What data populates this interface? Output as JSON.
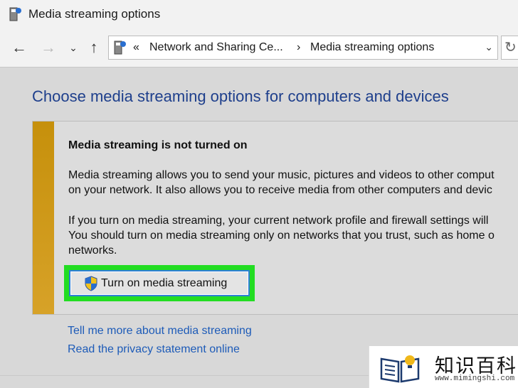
{
  "window": {
    "title": "Media streaming options"
  },
  "nav": {
    "back_icon": "←",
    "forward_icon": "→",
    "recent_icon": "⌄",
    "up_icon": "↑",
    "breadcrumb_sep_overflow": "«",
    "breadcrumb": [
      "Network and Sharing Ce...",
      "Media streaming options"
    ],
    "breadcrumb_sep": "›",
    "dropdown_icon": "⌄",
    "refresh_icon": "↻"
  },
  "main": {
    "heading": "Choose media streaming options for computers and devices",
    "notice": {
      "title": "Media streaming is not turned on",
      "para1": [
        "Media streaming allows you to send your music, pictures and videos to other comput",
        "on your network.  It also allows you to receive media from other computers and devic"
      ],
      "para2": [
        "If you turn on media streaming, your current network profile and firewall settings will",
        "You should turn on media streaming only on networks that you trust, such as home o",
        "networks."
      ],
      "button_label": "Turn on media streaming"
    },
    "links": [
      "Tell me more about media streaming",
      "Read the privacy statement online"
    ]
  },
  "watermark": {
    "text": "知识百科",
    "url": "www.mimingshi.com"
  },
  "colors": {
    "heading": "#1e3f8c",
    "link": "#1d5bb8",
    "accent_strip": "#c6900b",
    "highlight": "#22dd22"
  }
}
